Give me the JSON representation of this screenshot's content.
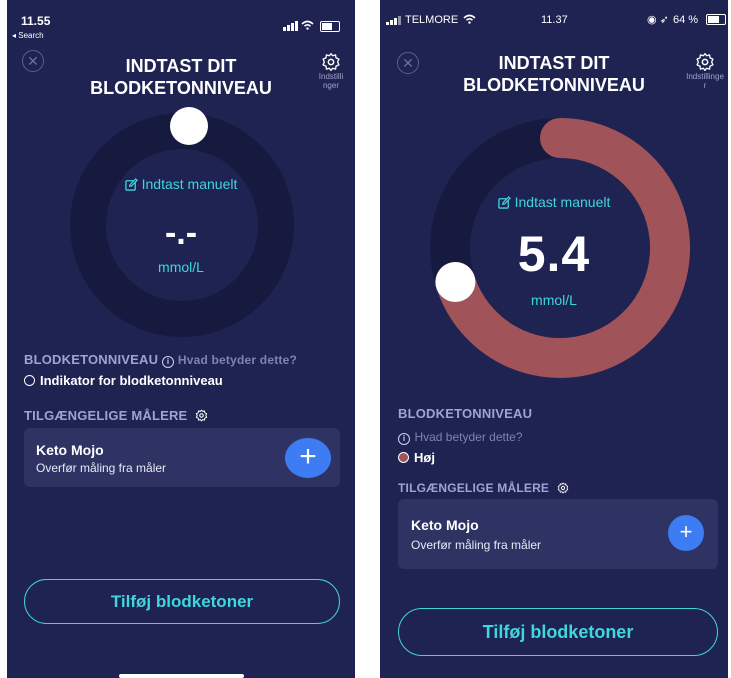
{
  "left": {
    "status": {
      "time": "11.55",
      "back": "◂ Search"
    },
    "title_line1": "INDTAST DIT",
    "title_line2": "BLODKETONNIVEAU",
    "settings_label": "Indstillinger",
    "manual_entry": "Indtast manuelt",
    "value": "-.-",
    "unit": "mmol/L",
    "ketone_label": "BLODKETONNIVEAU",
    "info_question": "Hvad betyder dette?",
    "indicator": "Indikator for blodketonniveau",
    "meters_label": "TILGÆNGELIGE MÅLERE",
    "meter": {
      "name": "Keto Mojo",
      "subtitle": "Overfør måling fra måler",
      "add": "+"
    },
    "cta": "Tilføj blodketoner",
    "gauge_fraction": 0
  },
  "right": {
    "status": {
      "carrier": "TELMORE",
      "time": "11.37",
      "battery": "64 %"
    },
    "title_line1": "INDTAST DIT",
    "title_line2": "BLODKETONNIVEAU",
    "settings_label": "Indstillinger",
    "manual_entry": "Indtast manuelt",
    "value": "5.4",
    "unit": "mmol/L",
    "ketone_label": "BLODKETONNIVEAU",
    "info_question": "Hvad betyder dette?",
    "indicator": "Høj",
    "indicator_color": "#a0545a",
    "meters_label": "TILGÆNGELIGE MÅLERE",
    "meter": {
      "name": "Keto Mojo",
      "subtitle": "Overfør måling fra måler",
      "add": "+"
    },
    "cta": "Tilføj blodketoner",
    "gauge_fraction": 0.7
  },
  "colors": {
    "background": "#1f2352",
    "accent_teal": "#3fd6dc",
    "button_blue": "#3d7cf2",
    "gauge_high": "#a0545a",
    "ring_track": "#161a3f"
  }
}
